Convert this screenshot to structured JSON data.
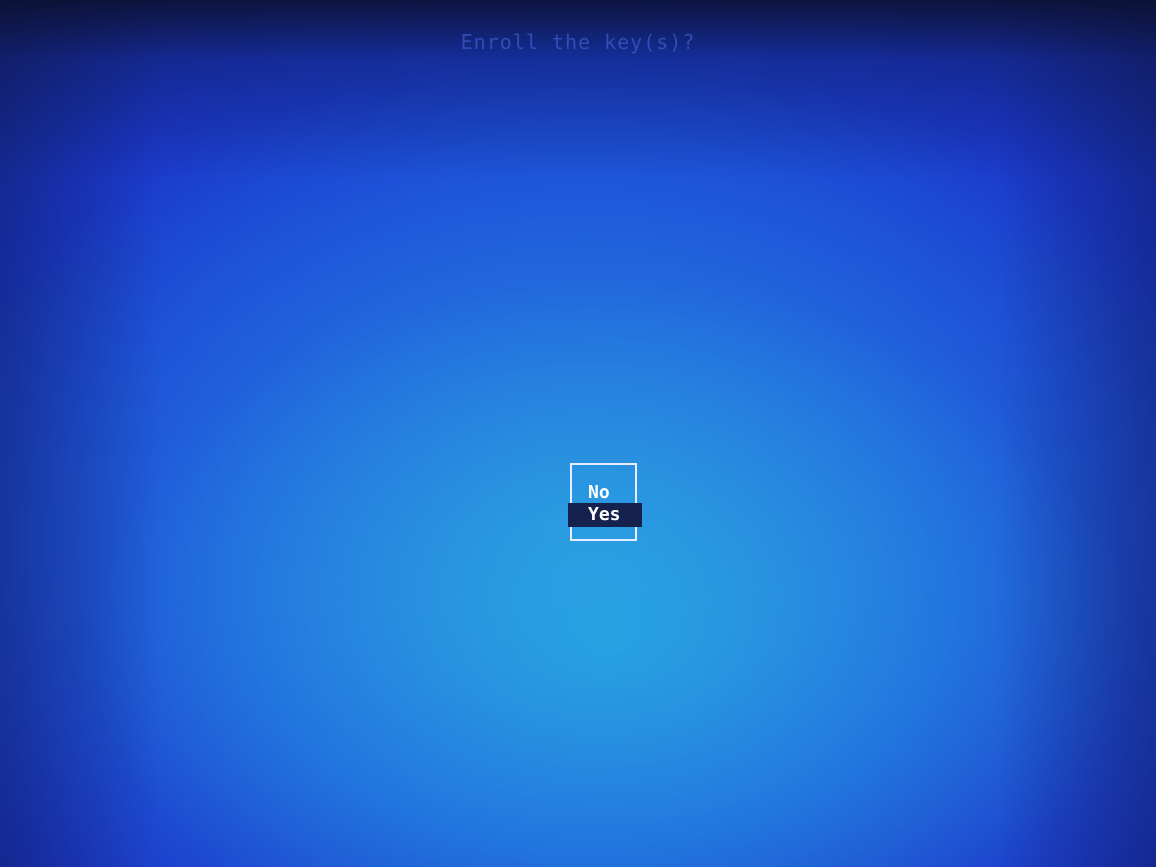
{
  "title": "Enroll the key(s)?",
  "options": [
    {
      "label": "No",
      "selected": false
    },
    {
      "label": "Yes",
      "selected": true
    }
  ],
  "colors": {
    "background": "#1a4fdc",
    "selection_highlight": "#16224e",
    "dialog_border": "#e8ecff",
    "text": "#ffffff"
  }
}
